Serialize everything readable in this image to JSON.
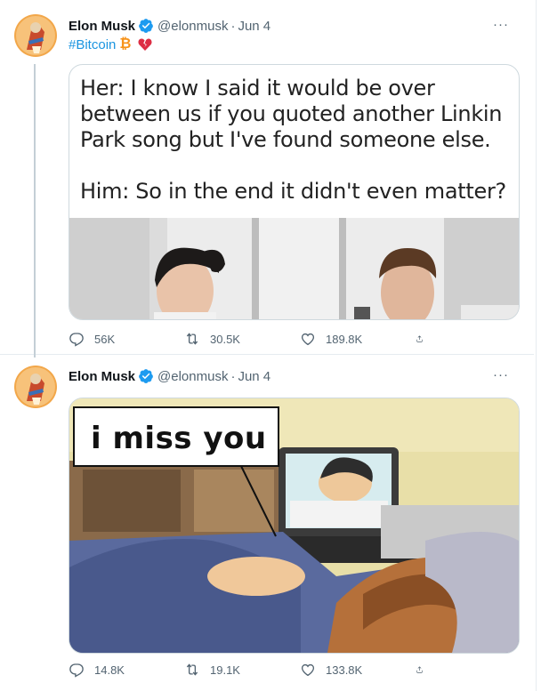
{
  "tweets": [
    {
      "name": "Elon Musk",
      "handle": "@elonmusk",
      "dot": "·",
      "date": "Jun 4",
      "more": "···",
      "hashtag": "#Bitcoin",
      "emoji_bitcoin": "₿",
      "emoji_heart": "💔",
      "meme_text_1": "Her: I know I said it would be over between us if you quoted another Linkin Park song but I've found someone else.",
      "meme_text_2": "Him: So in the end it didn't even matter?",
      "replies": "56K",
      "retweets": "30.5K",
      "likes": "189.8K"
    },
    {
      "name": "Elon Musk",
      "handle": "@elonmusk",
      "dot": "·",
      "date": "Jun 4",
      "more": "···",
      "meme_caption": "i miss you",
      "replies": "14.8K",
      "retweets": "19.1K",
      "likes": "133.8K"
    }
  ],
  "colors": {
    "accent": "#1b95e0",
    "verified": "#1d9bf0",
    "muted": "#536471",
    "border": "#cfd9de"
  }
}
